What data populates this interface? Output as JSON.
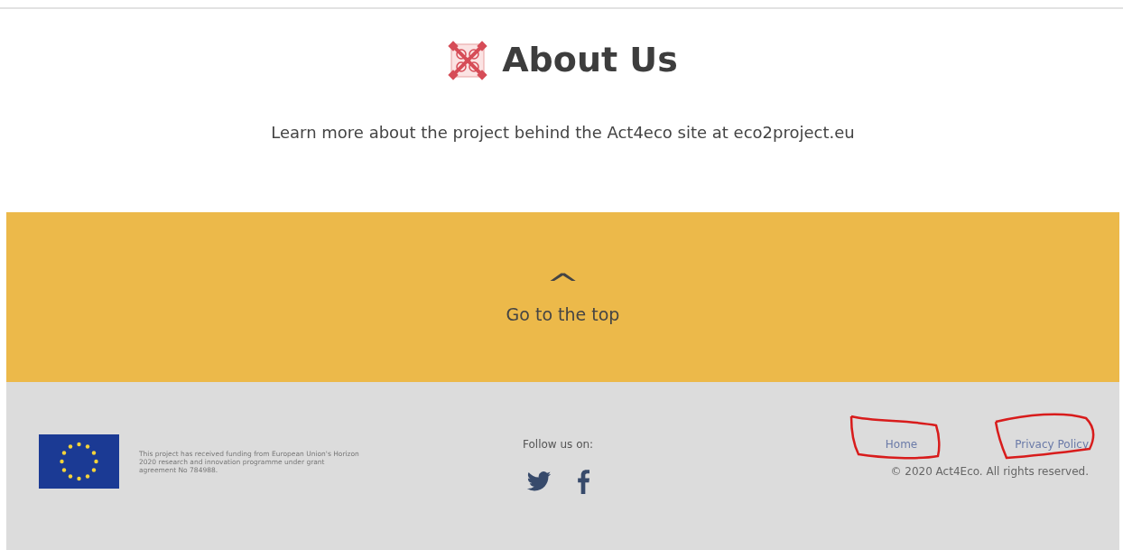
{
  "about": {
    "title": "About Us",
    "text": "Learn more about the project behind the Act4eco site at eco2project.eu"
  },
  "top_link": {
    "icon": "^",
    "label": "Go to the top"
  },
  "footer": {
    "funding": "This project has received funding from European Union's Horizon 2020 research and innovation programme under grant agreement No 784988.",
    "follow_label": "Follow us on:",
    "links": [
      "Home",
      "Privacy Policy"
    ],
    "copyright": "© 2020 Act4Eco. All rights reserved."
  }
}
